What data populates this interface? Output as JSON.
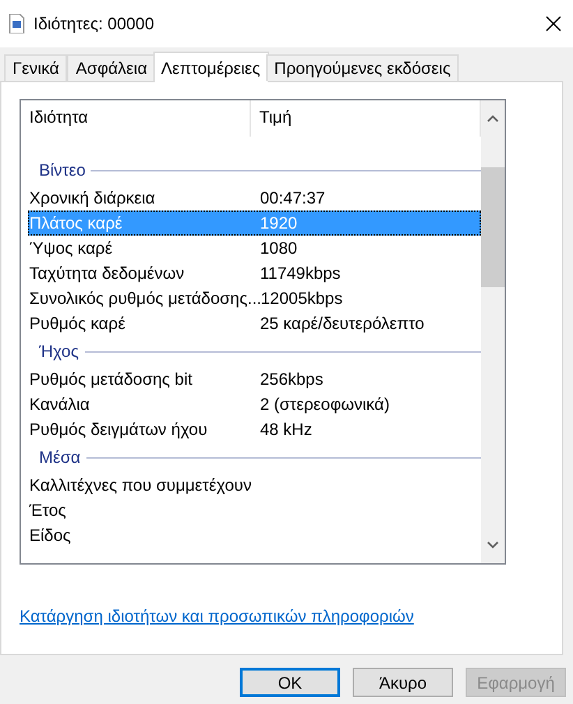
{
  "window": {
    "title": "Ιδιότητες: 00000"
  },
  "tabs": [
    {
      "label": "Γενικά",
      "selected": false
    },
    {
      "label": "Ασφάλεια",
      "selected": false
    },
    {
      "label": "Λεπτομέρειες",
      "selected": true
    },
    {
      "label": "Προηγούμενες εκδόσεις",
      "selected": false
    }
  ],
  "table": {
    "columns": [
      "Ιδιότητα",
      "Τιμή"
    ],
    "groups": [
      {
        "title": "Βίντεο",
        "rows": [
          {
            "name": "Χρονική διάρκεια",
            "value": "00:47:37",
            "selected": false
          },
          {
            "name": "Πλάτος καρέ",
            "value": "1920",
            "selected": true
          },
          {
            "name": "Ύψος καρέ",
            "value": "1080",
            "selected": false
          },
          {
            "name": "Ταχύτητα δεδομένων",
            "value": "11749kbps",
            "selected": false
          },
          {
            "name": "Συνολικός ρυθμός μετάδοσης...",
            "value": "12005kbps",
            "selected": false
          },
          {
            "name": "Ρυθμός καρέ",
            "value": "25 καρέ/δευτερόλεπτο",
            "selected": false
          }
        ]
      },
      {
        "title": "Ήχος",
        "rows": [
          {
            "name": "Ρυθμός μετάδοσης bit",
            "value": "256kbps",
            "selected": false
          },
          {
            "name": "Κανάλια",
            "value": "2 (στερεοφωνικά)",
            "selected": false
          },
          {
            "name": "Ρυθμός δειγμάτων ήχου",
            "value": "48 kHz",
            "selected": false
          }
        ]
      },
      {
        "title": "Μέσα",
        "rows": [
          {
            "name": "Καλλιτέχνες που συμμετέχουν",
            "selected": false
          },
          {
            "name": "Έτος",
            "selected": false
          },
          {
            "name": "Είδος",
            "selected": false
          }
        ]
      }
    ]
  },
  "link": "Κατάργηση ιδιοτήτων και προσωπικών πληροφοριών",
  "buttons": [
    {
      "label": "OK",
      "focused": true,
      "disabled": false
    },
    {
      "label": "Άκυρο",
      "focused": false,
      "disabled": false
    },
    {
      "label": "Εφαρμογή",
      "focused": false,
      "disabled": true
    }
  ]
}
